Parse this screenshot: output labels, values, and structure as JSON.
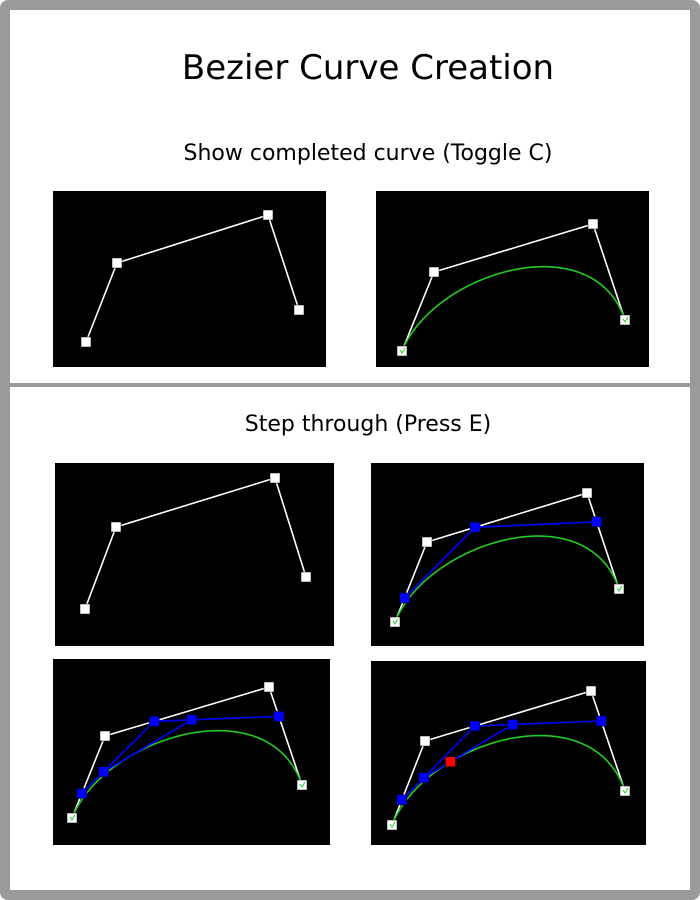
{
  "title": "Bezier Curve Creation",
  "sections": [
    {
      "heading": "Show completed curve (Toggle C)"
    },
    {
      "heading": "Step through (Press E)"
    }
  ],
  "colors": {
    "control": "#ffffff",
    "curve": "#22cc22",
    "intermediate": "#0000ff",
    "current_point": "#ff0000",
    "background": "#000000",
    "frame": "#9a9a9a"
  },
  "panels": [
    {
      "name": "completed-off",
      "show_curve": false,
      "step": 0
    },
    {
      "name": "completed-on",
      "show_curve": true,
      "step": 0
    },
    {
      "name": "step-0",
      "show_curve": false,
      "step": 0
    },
    {
      "name": "step-1",
      "show_curve": true,
      "step": 1
    },
    {
      "name": "step-2",
      "show_curve": true,
      "step": 2
    },
    {
      "name": "step-3",
      "show_curve": true,
      "step": 3
    }
  ]
}
